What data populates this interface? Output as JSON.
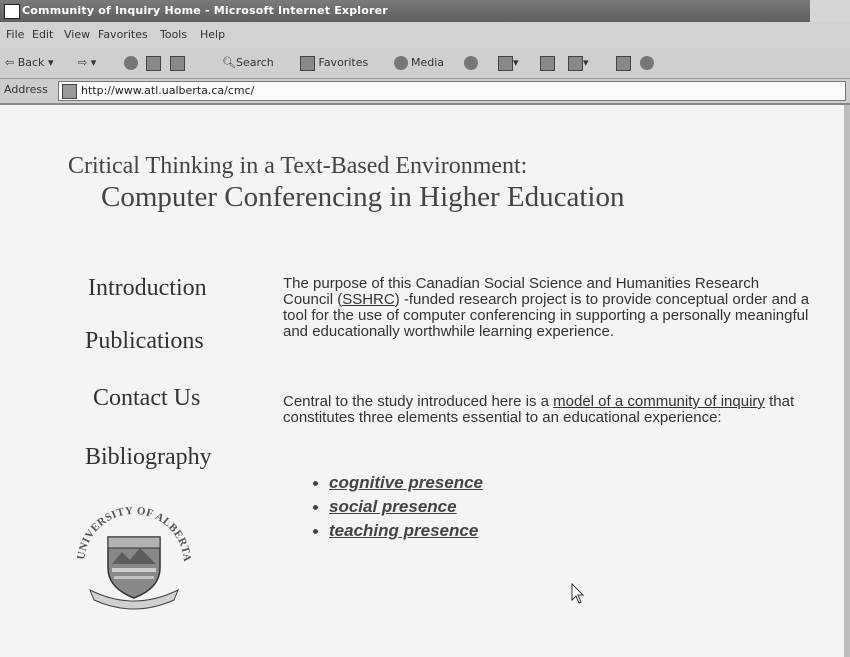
{
  "window": {
    "title": "Community of Inquiry Home - Microsoft Internet Explorer"
  },
  "menu": [
    "File",
    "Edit",
    "View",
    "Favorites",
    "Tools",
    "Help"
  ],
  "toolbar": {
    "back": "Back",
    "search": "Search",
    "favorites": "Favorites",
    "media": "Media"
  },
  "address": {
    "label": "Address",
    "url": "http://www.atl.ualberta.ca/cmc/"
  },
  "page": {
    "title_line1": "Critical Thinking in a Text-Based Environment:",
    "title_line2": "Computer Conferencing in Higher Education",
    "nav": [
      "Introduction",
      "Publications",
      "Contact Us",
      "Bibliography"
    ],
    "para1": {
      "before": "The purpose of this Canadian Social Science and Humanities Research Council (",
      "link": "SSHRC",
      "after": ") -funded research project is to provide conceptual order and a tool for the use of computer conferencing in supporting a personally meaningful and educationally worthwhile learning experience."
    },
    "para2": {
      "before": "Central to the study introduced here is a ",
      "link": "model of a community of inquiry",
      "after": " that constitutes three elements essential to an educational experience:"
    },
    "elements": [
      "cognitive presence",
      "social presence",
      "teaching presence"
    ],
    "logo": {
      "text": "UNIVERSITY OF ALBERTA"
    }
  }
}
